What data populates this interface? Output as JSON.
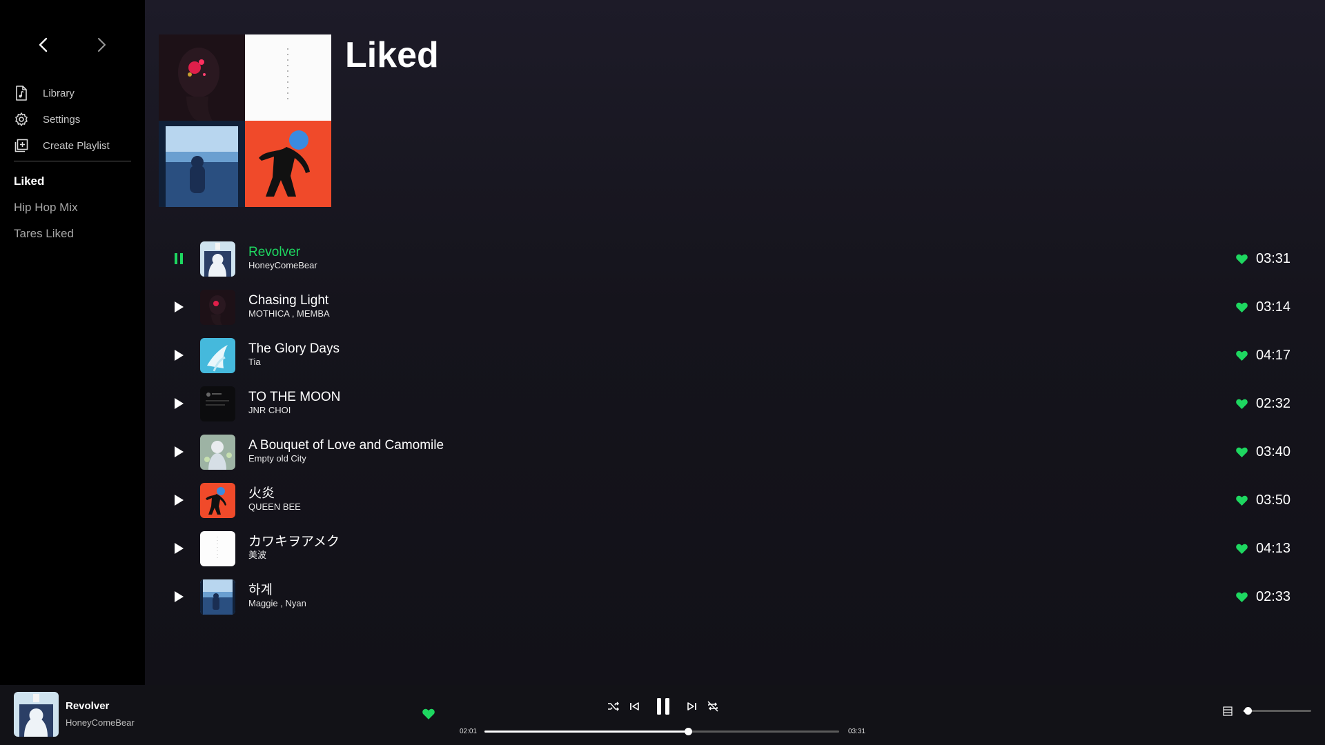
{
  "window": {
    "controls": [
      "minimize-icon",
      "maximize-icon",
      "close-icon"
    ]
  },
  "sidebar": {
    "nav": {
      "back_icon": "chevron-left-icon",
      "forward_icon": "chevron-right-icon"
    },
    "menu": [
      {
        "label": "Library",
        "icon": "music-file-icon"
      },
      {
        "label": "Settings",
        "icon": "gear-icon"
      },
      {
        "label": "Create Playlist",
        "icon": "add-playlist-icon"
      }
    ],
    "playlists": [
      {
        "label": "Liked",
        "active": true
      },
      {
        "label": "Hip Hop Mix",
        "active": false
      },
      {
        "label": "Tares Liked",
        "active": false
      }
    ]
  },
  "main": {
    "title": "Liked",
    "tracks": [
      {
        "title": "Revolver",
        "artist": "HoneyComeBear",
        "duration": "03:31",
        "playing": true,
        "liked": true
      },
      {
        "title": "Chasing Light",
        "artist": "MOTHICA , MEMBA",
        "duration": "03:14",
        "playing": false,
        "liked": true
      },
      {
        "title": "The Glory Days",
        "artist": "Tia",
        "duration": "04:17",
        "playing": false,
        "liked": true
      },
      {
        "title": "TO THE MOON",
        "artist": "JNR CHOI",
        "duration": "02:32",
        "playing": false,
        "liked": true
      },
      {
        "title": "A Bouquet of Love and Camomile",
        "artist": "Empty old City",
        "duration": "03:40",
        "playing": false,
        "liked": true
      },
      {
        "title": "火炎",
        "artist": "QUEEN BEE",
        "duration": "03:50",
        "playing": false,
        "liked": true
      },
      {
        "title": "カワキヲアメク",
        "artist": "美波",
        "duration": "04:13",
        "playing": false,
        "liked": true
      },
      {
        "title": "하계",
        "artist": "Maggie , Nyan",
        "duration": "02:33",
        "playing": false,
        "liked": true
      }
    ]
  },
  "player": {
    "title": "Revolver",
    "artist": "HoneyComeBear",
    "liked": true,
    "elapsed": "02:01",
    "total": "03:31",
    "progress": 0.573,
    "volume": 0.06,
    "controls": [
      "shuffle-icon",
      "previous-icon",
      "pause-icon",
      "next-icon",
      "repeat-off-icon"
    ]
  },
  "colors": {
    "accent": "#1ed760",
    "sidebar_bg": "#000000",
    "main_bg": "#15141c",
    "player_bg": "#121217"
  }
}
